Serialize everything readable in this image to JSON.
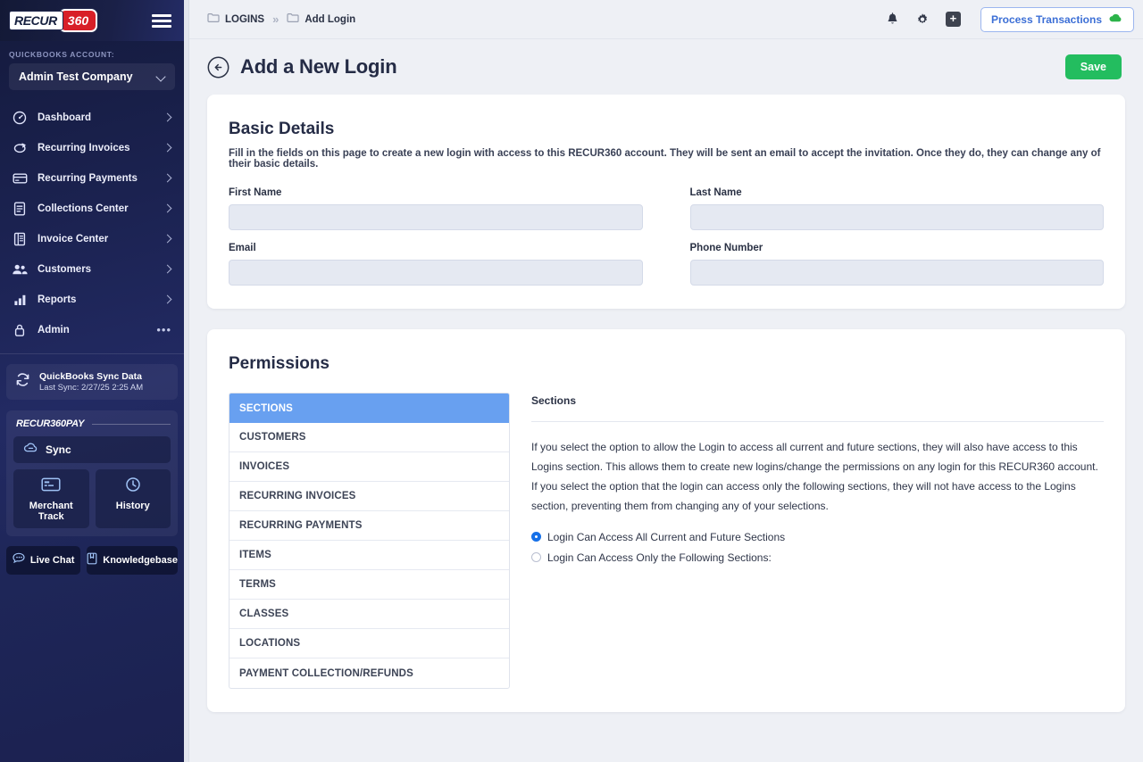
{
  "sidebar": {
    "logo": {
      "word1": "RECUR",
      "word2": "360"
    },
    "menu_icon": "hamburger-icon",
    "account": {
      "label": "QUICKBOOKS ACCOUNT:",
      "value": "Admin Test Company"
    },
    "nav": [
      {
        "label": "Dashboard",
        "icon": "dashboard-icon",
        "trailing": "chevron"
      },
      {
        "label": "Recurring Invoices",
        "icon": "recurring-invoices-icon",
        "trailing": "chevron"
      },
      {
        "label": "Recurring Payments",
        "icon": "credit-card-icon",
        "trailing": "chevron"
      },
      {
        "label": "Collections Center",
        "icon": "document-icon",
        "trailing": "chevron"
      },
      {
        "label": "Invoice Center",
        "icon": "invoice-icon",
        "trailing": "chevron"
      },
      {
        "label": "Customers",
        "icon": "people-icon",
        "trailing": "chevron"
      },
      {
        "label": "Reports",
        "icon": "bar-chart-icon",
        "trailing": "chevron"
      },
      {
        "label": "Admin",
        "icon": "lock-icon",
        "trailing": "dots"
      }
    ],
    "sync": {
      "title": "QuickBooks Sync Data",
      "subtitle": "Last Sync: 2/27/25 2:25 AM",
      "icon": "sync-refresh-icon"
    },
    "pay": {
      "brand": "RECUR360PAY",
      "sync_label": "Sync",
      "sync_icon": "cloud-sync-icon",
      "tiles": [
        {
          "label": "Merchant Track",
          "icon": "card-track-icon"
        },
        {
          "label": "History",
          "icon": "clock-icon"
        }
      ]
    },
    "help": [
      {
        "label": "Live Chat",
        "icon": "chat-bubble-icon"
      },
      {
        "label": "Knowledgebase",
        "icon": "bookmark-icon"
      }
    ]
  },
  "topbar": {
    "breadcrumbs": [
      {
        "label": "LOGINS",
        "icon": "folder-icon"
      },
      {
        "label": "Add Login",
        "icon": "folder-icon"
      }
    ],
    "separator": "»",
    "icons": [
      {
        "name": "bell-icon"
      },
      {
        "name": "gear-icon"
      },
      {
        "name": "plus-square-icon",
        "glyph": "+"
      }
    ],
    "process_button": {
      "label": "Process Transactions",
      "icon": "green-cloud-icon",
      "text_color": "#3c6fd6",
      "border_color": "#9cb6ef",
      "icon_color": "#2cb34a"
    }
  },
  "page": {
    "back_icon": "back-arrow-circle-icon",
    "title": "Add a New Login",
    "save_label": "Save",
    "save_color": "#23bd5f"
  },
  "basic_details": {
    "title": "Basic Details",
    "description": "Fill in the fields on this page to create a new login with access to this RECUR360 account. They will be sent an email to accept the invitation. Once they do, they can change any of their basic details.",
    "fields": [
      {
        "label": "First Name",
        "value": "",
        "placeholder": ""
      },
      {
        "label": "Last Name",
        "value": "",
        "placeholder": ""
      },
      {
        "label": "Email",
        "value": "",
        "placeholder": ""
      },
      {
        "label": "Phone Number",
        "value": "",
        "placeholder": ""
      }
    ]
  },
  "permissions": {
    "title": "Permissions",
    "table": {
      "header": "SECTIONS",
      "header_color": "#68a0f0",
      "rows": [
        "CUSTOMERS",
        "INVOICES",
        "RECURRING INVOICES",
        "RECURRING PAYMENTS",
        "ITEMS",
        "TERMS",
        "CLASSES",
        "LOCATIONS",
        "PAYMENT COLLECTION/REFUNDS"
      ]
    },
    "right": {
      "title": "Sections",
      "paragraph": "If you select the option to allow the Login to access all current and future sections, they will also have access to this Logins section. This allows them to create new logins/change the permissions on any login for this RECUR360 account. If you select the option that the login can access only the following sections, they will not have access to the Logins section, preventing them from changing any of your selections.",
      "options": [
        {
          "label": "Login Can Access All Current and Future Sections",
          "selected": true
        },
        {
          "label": "Login Can Access Only the Following Sections:",
          "selected": false
        }
      ]
    }
  }
}
